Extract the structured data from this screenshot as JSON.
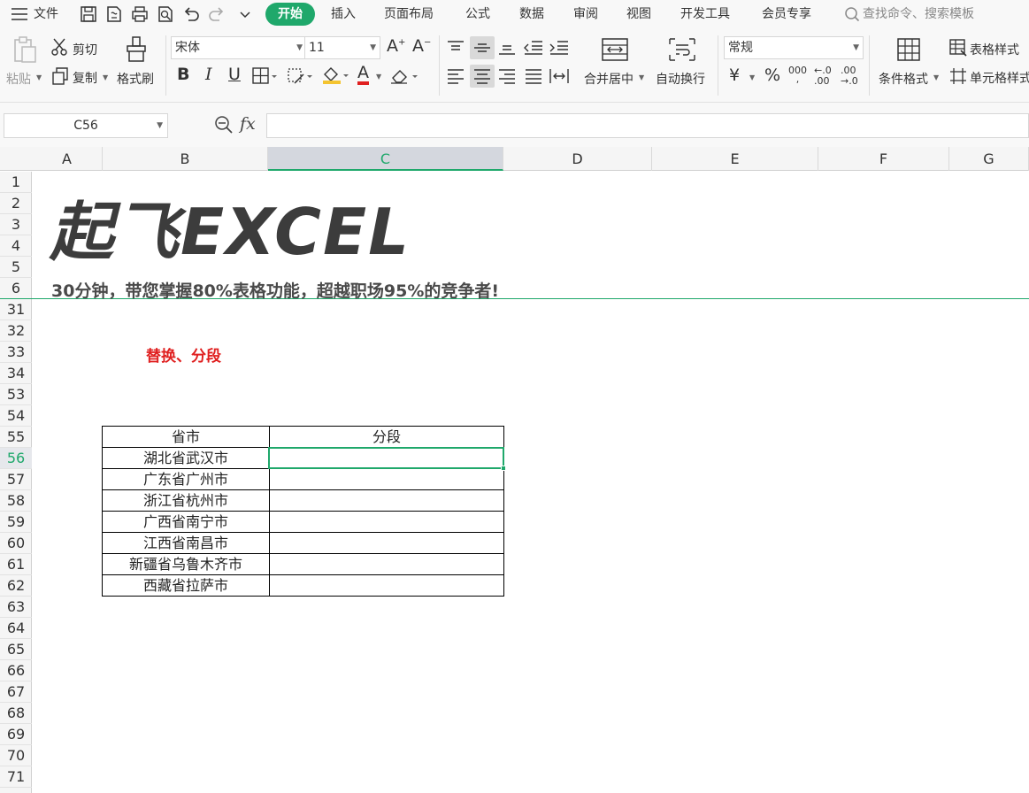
{
  "menu": {
    "file": "文件",
    "tabs": [
      "开始",
      "插入",
      "页面布局",
      "公式",
      "数据",
      "审阅",
      "视图",
      "开发工具",
      "会员专享"
    ],
    "search_placeholder": "查找命令、搜索模板"
  },
  "ribbon": {
    "paste": "粘贴",
    "cut": "剪切",
    "copy": "复制",
    "format_painter": "格式刷",
    "font_name": "宋体",
    "font_size": "11",
    "merge_center": "合并居中",
    "wrap_text": "自动换行",
    "number_format": "常规",
    "conditional_format": "条件格式",
    "table_style": "表格样式",
    "cell_style": "单元格样式"
  },
  "formula_bar": {
    "cell_ref": "C56",
    "fx": "fx",
    "formula": ""
  },
  "grid": {
    "columns": [
      "A",
      "B",
      "C",
      "D",
      "E",
      "F",
      "G"
    ],
    "active_column": "C",
    "rows": [
      "1",
      "2",
      "3",
      "4",
      "5",
      "6",
      "31",
      "32",
      "33",
      "34",
      "53",
      "54",
      "55",
      "56",
      "57",
      "58",
      "59",
      "60",
      "61",
      "62",
      "63",
      "64",
      "65",
      "66",
      "67",
      "68",
      "69",
      "70",
      "71"
    ],
    "active_row": "56"
  },
  "sheet": {
    "logo": "起飞EXCEL",
    "slogan": "30分钟，带您掌握80%表格功能，超越职场95%的竞争者!",
    "section_title": "替换、分段",
    "table": {
      "headers": [
        "省市",
        "分段"
      ],
      "rows": [
        [
          "湖北省武汉市",
          ""
        ],
        [
          "广东省广州市",
          ""
        ],
        [
          "浙江省杭州市",
          ""
        ],
        [
          "广西省南宁市",
          ""
        ],
        [
          "江西省南昌市",
          ""
        ],
        [
          "新疆省乌鲁木齐市",
          ""
        ],
        [
          "西藏省拉萨市",
          ""
        ]
      ]
    }
  },
  "colors": {
    "accent": "#1fa86b",
    "title_red": "#e02020"
  }
}
